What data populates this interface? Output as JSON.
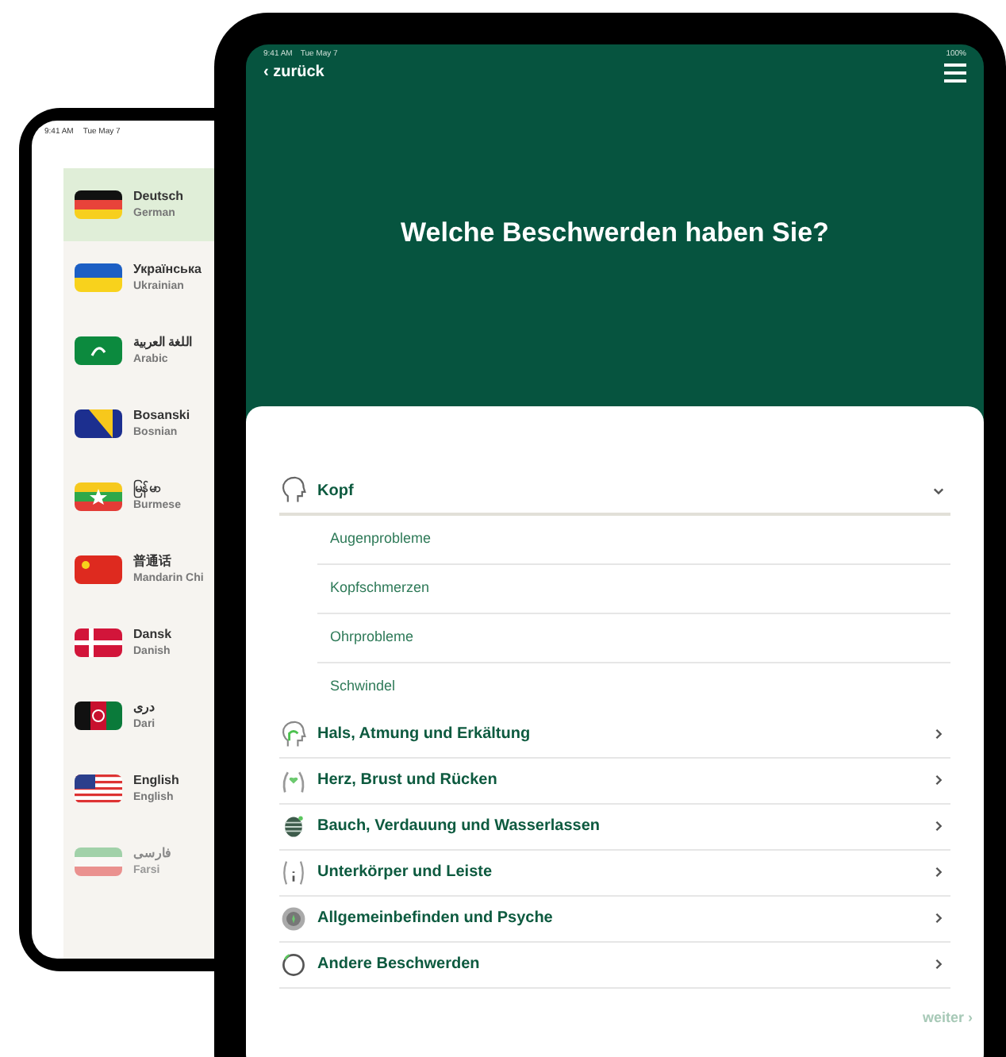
{
  "back_tablet": {
    "status_bar": {
      "time": "9:41 AM",
      "date": "Tue May 7"
    },
    "languages": [
      {
        "kind": "de",
        "name": "Deutsch",
        "english": "German",
        "selected": true,
        "faded": false
      },
      {
        "kind": "ua",
        "name": "Українська",
        "english": "Ukrainian",
        "selected": false,
        "faded": false
      },
      {
        "kind": "ar",
        "name": "اللغة العربية",
        "english": "Arabic",
        "selected": false,
        "faded": false
      },
      {
        "kind": "ba",
        "name": "Bosanski",
        "english": "Bosnian",
        "selected": false,
        "faded": false
      },
      {
        "kind": "mm",
        "name": "မြန်မာ",
        "english": "Burmese",
        "selected": false,
        "faded": false
      },
      {
        "kind": "cn",
        "name": "普通话",
        "english": "Mandarin Chi",
        "selected": false,
        "faded": false
      },
      {
        "kind": "dk",
        "name": "Dansk",
        "english": "Danish",
        "selected": false,
        "faded": false
      },
      {
        "kind": "af",
        "name": "دری",
        "english": "Dari",
        "selected": false,
        "faded": false
      },
      {
        "kind": "us",
        "name": "English",
        "english": "English",
        "selected": false,
        "faded": false
      },
      {
        "kind": "ir",
        "name": "فارسی",
        "english": "Farsi",
        "selected": false,
        "faded": true
      }
    ]
  },
  "front_tablet": {
    "status_bar": {
      "time": "9:41 AM",
      "date": "Tue May 7",
      "battery": "100%"
    },
    "back": "‹ zurück",
    "title": "Welche Beschwerden haben Sie?",
    "categories": [
      {
        "label": "Kopf",
        "expanded": true,
        "children": [
          {
            "label": "Augenprobleme"
          },
          {
            "label": "Kopfschmerzen"
          },
          {
            "label": "Ohrprobleme"
          },
          {
            "label": "Schwindel"
          }
        ]
      },
      {
        "label": "Hals, Atmung und Erkältung",
        "expanded": false
      },
      {
        "label": "Herz, Brust und Rücken",
        "expanded": false
      },
      {
        "label": "Bauch, Verdauung und Wasserlassen",
        "expanded": false
      },
      {
        "label": "Unterkörper und Leiste",
        "expanded": false
      },
      {
        "label": "Allgemeinbefinden und Psyche",
        "expanded": false
      },
      {
        "label": "Andere Beschwerden",
        "expanded": false
      }
    ],
    "next": "weiter ›"
  }
}
